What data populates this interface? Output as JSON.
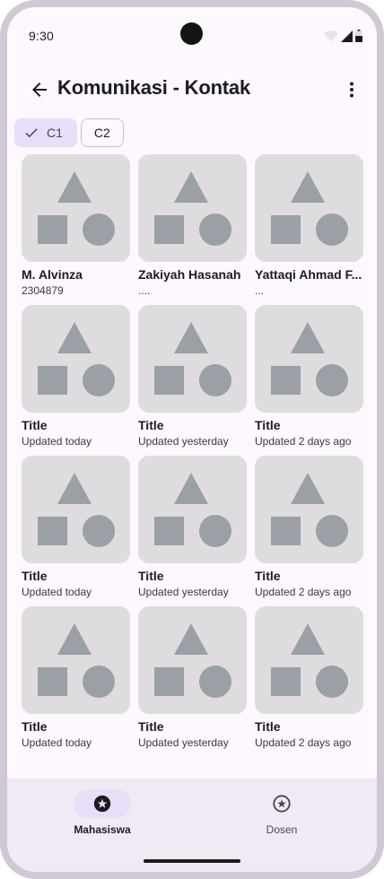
{
  "status_bar": {
    "time": "9:30",
    "icons": [
      "wifi-icon",
      "cellular-signal-icon",
      "battery-icon"
    ]
  },
  "top_bar": {
    "title": "Komunikasi - Kontak",
    "back_icon": "arrow-back-icon",
    "menu_icon": "more-vert-icon"
  },
  "chips": [
    {
      "label": "C1",
      "selected": true
    },
    {
      "label": "C2",
      "selected": false
    }
  ],
  "grid": {
    "items": [
      {
        "title": "M. Alvinza",
        "subtitle": "2304879"
      },
      {
        "title": "Zakiyah Hasanah",
        "subtitle": "...."
      },
      {
        "title": "Yattaqi Ahmad F...",
        "subtitle": "..."
      },
      {
        "title": "Title",
        "subtitle": "Updated today"
      },
      {
        "title": "Title",
        "subtitle": "Updated yesterday"
      },
      {
        "title": "Title",
        "subtitle": "Updated 2 days ago"
      },
      {
        "title": "Title",
        "subtitle": "Updated today"
      },
      {
        "title": "Title",
        "subtitle": "Updated yesterday"
      },
      {
        "title": "Title",
        "subtitle": "Updated 2 days ago"
      },
      {
        "title": "Title",
        "subtitle": "Updated today"
      },
      {
        "title": "Title",
        "subtitle": "Updated yesterday"
      },
      {
        "title": "Title",
        "subtitle": "Updated 2 days ago"
      }
    ]
  },
  "bottom_nav": {
    "items": [
      {
        "label": "Mahasiswa",
        "icon": "star-circle-icon",
        "active": true
      },
      {
        "label": "Dosen",
        "icon": "star-circle-outline-icon",
        "active": false
      }
    ]
  },
  "colors": {
    "background": "#fdf7fe",
    "accent_container": "#e8def8",
    "placeholder": "#dedcdf",
    "placeholder_shapes": "#9aa0a6",
    "nav_background": "#f1eaf5"
  }
}
